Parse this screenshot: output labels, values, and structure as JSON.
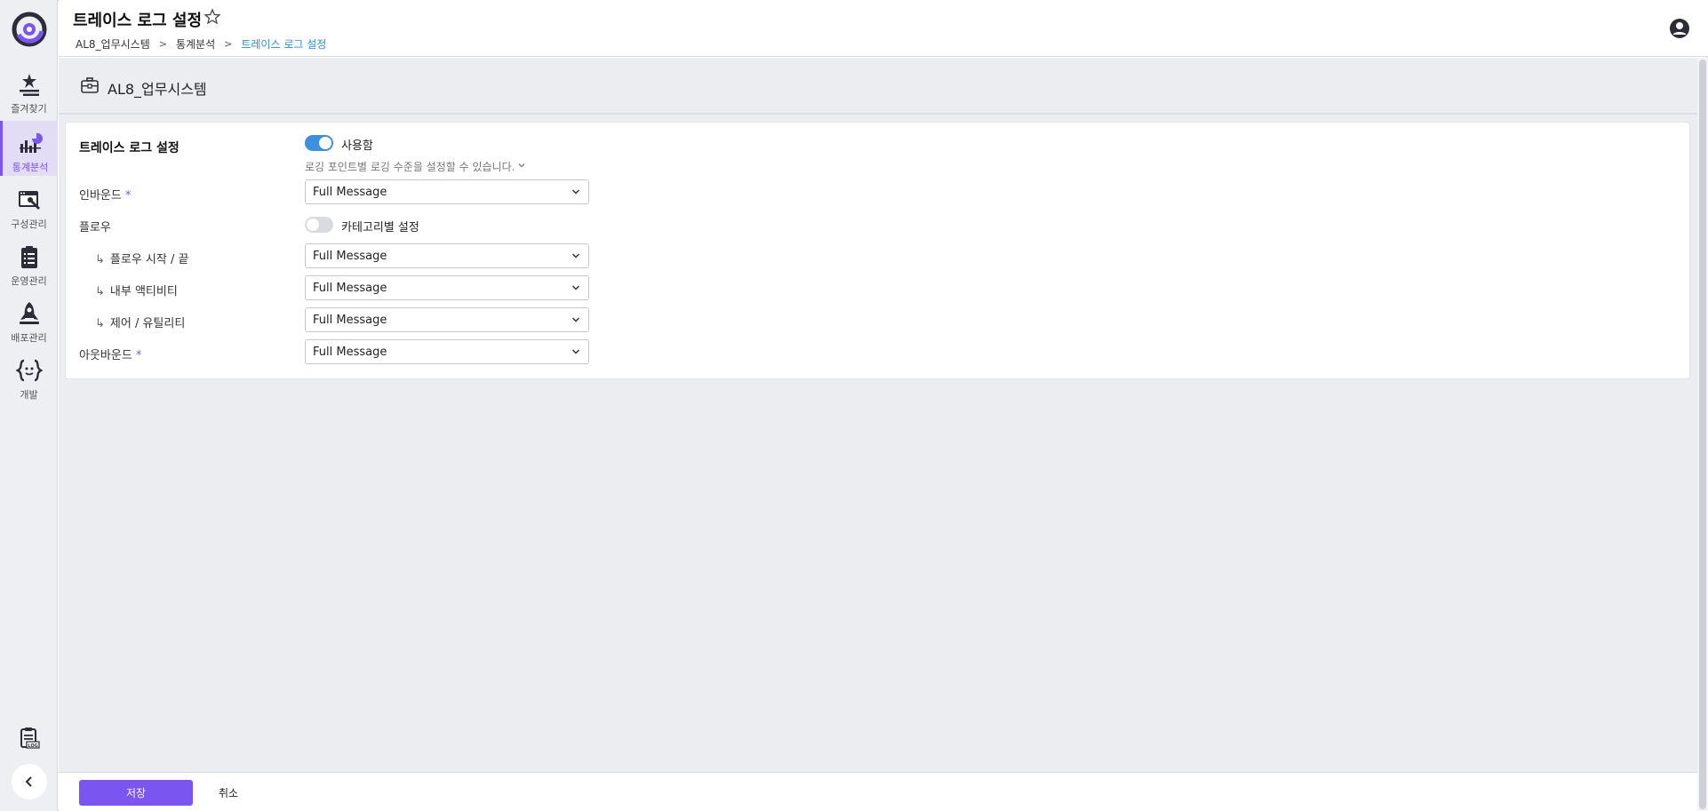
{
  "header": {
    "title": "트레이스 로그 설정",
    "breadcrumb": [
      "AL8_업무시스템",
      "통계분석",
      "트레이스 로그 설정"
    ]
  },
  "sidebar": {
    "items": [
      {
        "label": "즐겨찾기",
        "icon": "star-list-icon"
      },
      {
        "label": "통계분석",
        "icon": "chart-icon"
      },
      {
        "label": "구성관리",
        "icon": "config-icon"
      },
      {
        "label": "운영관리",
        "icon": "clipboard-icon"
      },
      {
        "label": "배포관리",
        "icon": "rocket-icon"
      },
      {
        "label": "개발",
        "icon": "code-braces-icon"
      }
    ],
    "log_icon": "log-icon",
    "collapse_icon": "chevron-left-icon"
  },
  "system": {
    "title": "AL8_업무시스템"
  },
  "settings": {
    "title": "트레이스 로그 설정",
    "enable_label": "사용함",
    "enabled": true,
    "hint": "로깅 포인트별 로깅 수준을 설정할 수 있습니다.",
    "inbound": {
      "label": "인바운드",
      "value": "Full Message"
    },
    "flow": {
      "label": "플로우",
      "toggle_label": "카테고리별 설정",
      "enabled": false
    },
    "flow_start_end": {
      "label": "플로우 시작 / 끝",
      "value": "Full Message"
    },
    "internal_activity": {
      "label": "내부 액티비티",
      "value": "Full Message"
    },
    "control_utility": {
      "label": "제어 / 유틸리티",
      "value": "Full Message"
    },
    "outbound": {
      "label": "아웃바운드",
      "value": "Full Message"
    },
    "required_mark": "*",
    "sub_arrow": "↳"
  },
  "footer": {
    "save_label": "저장",
    "cancel_label": "취소"
  },
  "colors": {
    "accent": "#7b55f0",
    "toggle_on": "#3d8fe0",
    "breadcrumb_current": "#2a8fd8"
  }
}
